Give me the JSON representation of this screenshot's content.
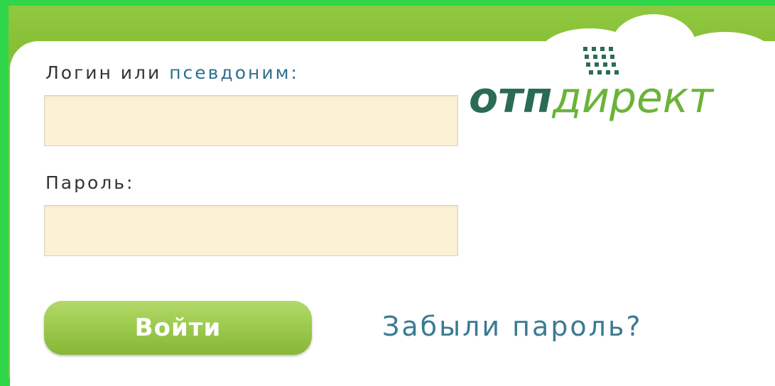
{
  "login_form": {
    "login_label": "Логин или ",
    "login_label_alias": "псевдоним:",
    "password_label": "Пароль:",
    "login_value": "",
    "password_value": "",
    "submit_label": "Войти",
    "forgot_link": "Забыли пароль?"
  },
  "logo": {
    "brand_bold": "отп",
    "brand_light": "директ",
    "icon": "dot-grid-logo-icon"
  },
  "colors": {
    "border_green": "#2fd64a",
    "header_green": "#8fc63c",
    "input_bg": "#fdf1d5",
    "link_blue": "#3a7a92",
    "button_green": "#9dcb4e"
  }
}
